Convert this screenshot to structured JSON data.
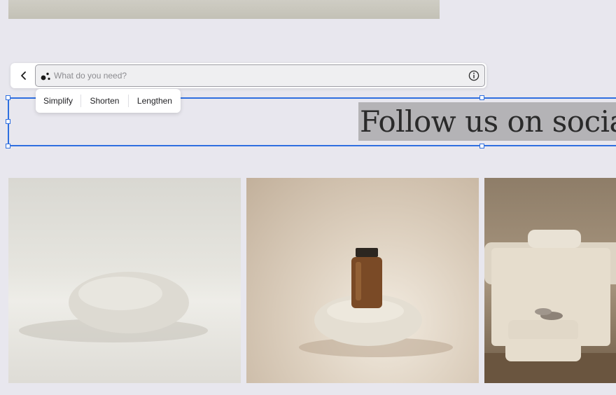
{
  "ai_prompt": {
    "placeholder": "What do you need?",
    "back_icon": "chevron-left-icon",
    "ai_icon": "sparkle-dots-icon",
    "info_icon": "info-icon"
  },
  "suggestions": [
    "Simplify",
    "Shorten",
    "Lengthen"
  ],
  "heading": {
    "text": "Follow us on social"
  },
  "gallery": [
    {
      "name": "white-stone-image"
    },
    {
      "name": "amber-bottle-on-stone-image"
    },
    {
      "name": "massage-table-towels-image"
    }
  ],
  "colors": {
    "selection": "#2f6fe0",
    "background": "#e8e7ee",
    "highlight": "#b4b3b6"
  }
}
